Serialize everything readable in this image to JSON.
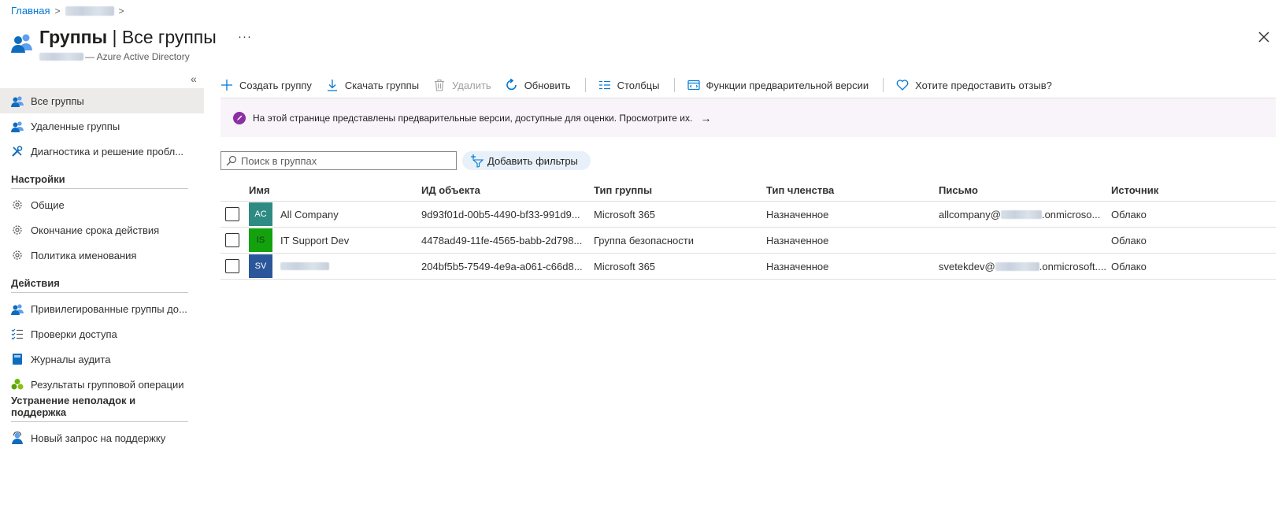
{
  "breadcrumb": {
    "home": "Главная"
  },
  "header": {
    "title_main": "Группы",
    "title_sep": " | ",
    "title_sub": "Все группы",
    "subtitle": "— Azure Active Directory"
  },
  "sidebar": {
    "top_items": [
      {
        "label": "Все группы"
      },
      {
        "label": "Удаленные группы"
      },
      {
        "label": "Диагностика и решение пробл..."
      }
    ],
    "sections": [
      {
        "title": "Настройки",
        "items": [
          {
            "label": "Общие"
          },
          {
            "label": "Окончание срока действия"
          },
          {
            "label": "Политика именования"
          }
        ]
      },
      {
        "title": "Действия",
        "items": [
          {
            "label": "Привилегированные группы до..."
          },
          {
            "label": "Проверки доступа"
          },
          {
            "label": "Журналы аудита"
          },
          {
            "label": "Результаты групповой операции"
          }
        ]
      },
      {
        "title": "Устранение неполадок и поддержка",
        "items": [
          {
            "label": "Новый запрос на поддержку"
          }
        ]
      }
    ]
  },
  "toolbar": {
    "create": "Создать группу",
    "download": "Скачать группы",
    "delete": "Удалить",
    "refresh": "Обновить",
    "columns": "Столбцы",
    "preview": "Функции предварительной версии",
    "feedback": "Хотите предоставить отзыв?"
  },
  "banner": {
    "text": "На этой странице представлены предварительные версии, доступные для оценки. Просмотрите их.",
    "arrow": "→"
  },
  "search": {
    "placeholder": "Поиск в группах"
  },
  "filter": {
    "label": "Добавить фильтры"
  },
  "table": {
    "headers": {
      "name": "Имя",
      "object_id": "ИД объекта",
      "group_type": "Тип группы",
      "membership": "Тип членства",
      "mail": "Письмо",
      "source": "Источник"
    },
    "rows": [
      {
        "initials": "AC",
        "avatar_color": "#2e8b83",
        "name": "All Company",
        "object_id": "9d93f01d-00b5-4490-bf33-991d9...",
        "group_type": "Microsoft 365",
        "membership": "Назначенное",
        "mail_prefix": "allcompany@",
        "mail_suffix": ".onmicroso...",
        "source": "Облако"
      },
      {
        "initials": "IS",
        "avatar_color": "#13a10e",
        "name": "IT Support Dev",
        "object_id": "4478ad49-11fe-4565-babb-2d798...",
        "group_type": "Группа безопасности",
        "membership": "Назначенное",
        "mail_prefix": "",
        "mail_suffix": "",
        "source": "Облако"
      },
      {
        "initials": "SV",
        "avatar_color": "#2b579a",
        "name": "",
        "object_id": "204bf5b5-7549-4e9a-a061-c66d8...",
        "group_type": "Microsoft 365",
        "membership": "Назначенное",
        "mail_prefix": "svetekdev@",
        "mail_suffix": ".onmicrosoft....",
        "source": "Облако"
      }
    ]
  }
}
